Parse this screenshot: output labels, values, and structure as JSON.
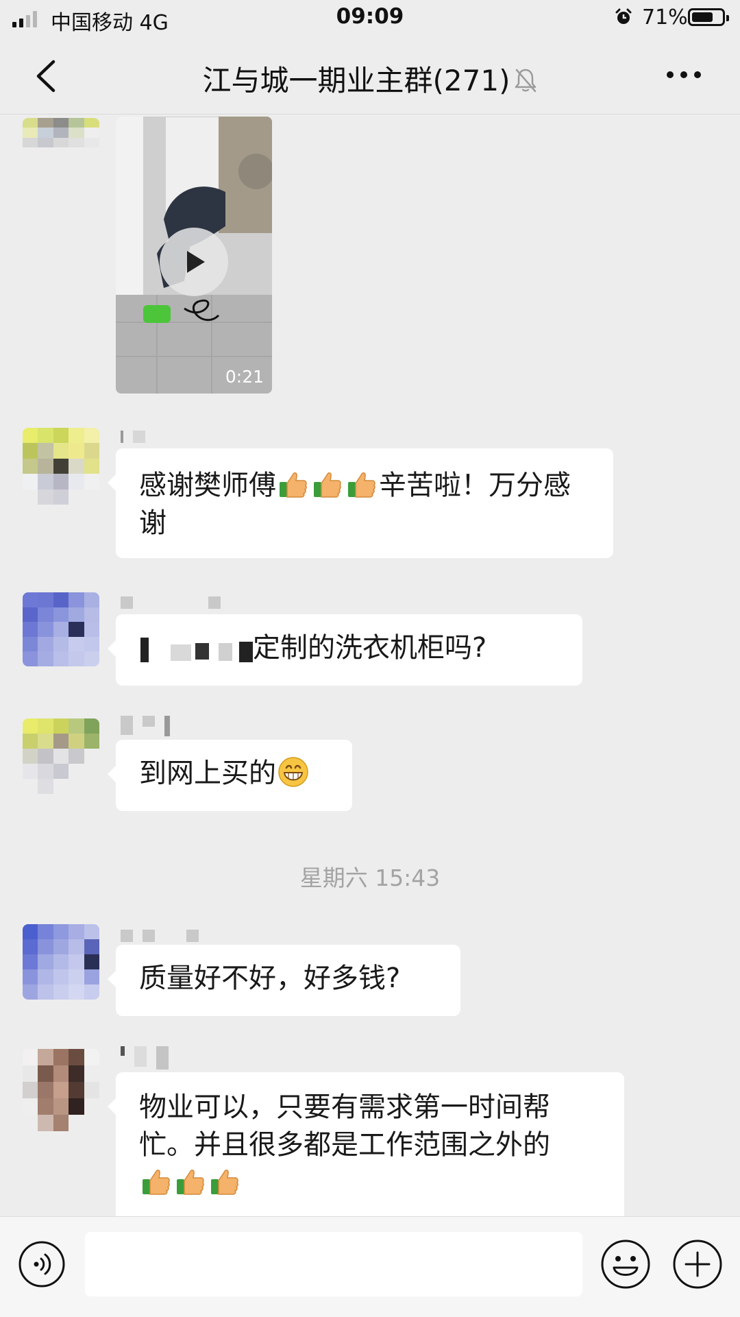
{
  "status_bar": {
    "carrier": "中国移动  4G",
    "time": "09:09",
    "battery_percent": "71%",
    "battery_level": 0.71,
    "signal_bars_active": 2,
    "icons": [
      "signal-icon",
      "alarm-icon",
      "battery-icon"
    ]
  },
  "nav": {
    "title": "江与城一期业主群(271)",
    "icons": [
      "back-icon",
      "mute-bell-icon",
      "more-icon"
    ]
  },
  "messages": [
    {
      "type": "video",
      "duration": "0:21"
    },
    {
      "type": "text",
      "text_before": "感谢樊师傅",
      "thumbs": 3,
      "text_after": "辛苦啦！万分感谢"
    },
    {
      "type": "text",
      "text_visible": "定制的洗衣机柜吗?"
    },
    {
      "type": "text",
      "text": "到网上买的",
      "emoji": "grin-emoji"
    },
    {
      "type": "text",
      "text": "质量好不好，好多钱?"
    },
    {
      "type": "text",
      "text": "物业可以，只要有需求第一时间帮忙。并且很多都是工作范围之外的",
      "thumbs": 3
    }
  ],
  "timestamp": "星期六 15:43",
  "input_bar": {
    "placeholder": "",
    "icons": [
      "voice-icon",
      "emoji-icon",
      "plus-icon"
    ]
  },
  "colors": {
    "background": "#ededed",
    "bubble": "#ffffff",
    "text": "#191919",
    "timestamp": "#a3a3a3",
    "thumb": "#f4b26a",
    "sleeve": "#3a9d3a"
  }
}
